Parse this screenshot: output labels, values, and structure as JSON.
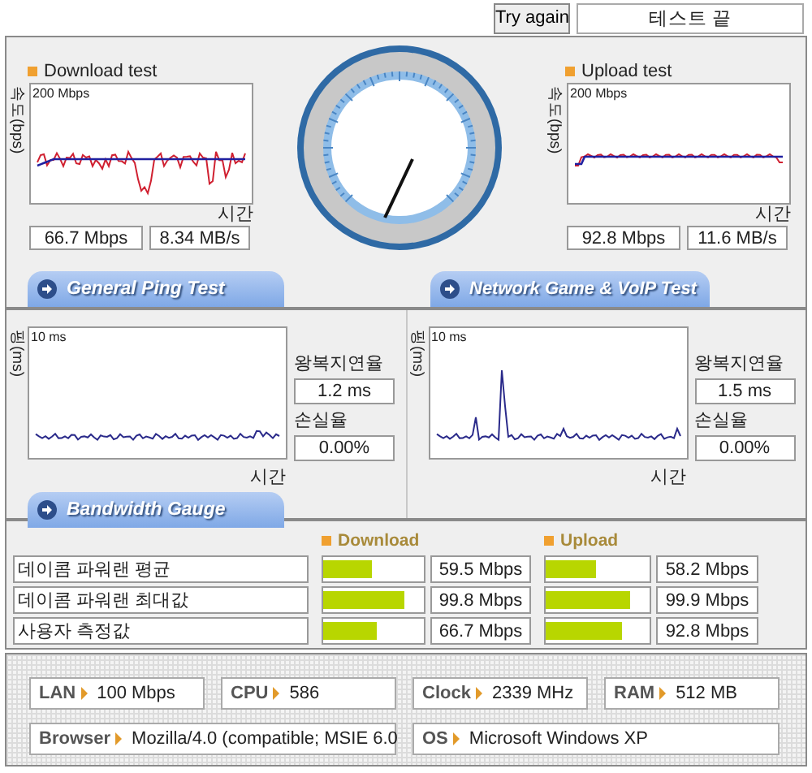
{
  "toolbar": {
    "retry_button": "Try again",
    "status": "테스트 끝"
  },
  "download": {
    "title": "Download test",
    "axis_label": "속도(bps)",
    "scale_label": "200 Mbps",
    "time_label": "시간",
    "rate": "66.7 Mbps",
    "bytes": "8.34 MB/s",
    "kind": "download"
  },
  "upload": {
    "title": "Upload test",
    "axis_label": "속도(bps)",
    "scale_label": "200 Mbps",
    "time_label": "시간",
    "rate": "92.8 Mbps",
    "bytes": "11.6 MB/s",
    "kind": "upload"
  },
  "ping_tab": "General Ping Test",
  "game_tab": "Network Game & VoIP Test",
  "ping": [
    {
      "axis_label": "핑(ms)",
      "scale_label": "10 ms",
      "time_label": "시간",
      "latency_label": "왕복지연율",
      "latency": "1.2 ms",
      "loss_label": "손실율",
      "loss": "0.00%",
      "kind": "flat"
    },
    {
      "axis_label": "핑(ms)",
      "scale_label": "10 ms",
      "time_label": "시간",
      "latency_label": "왕복지연율",
      "latency": "1.5 ms",
      "loss_label": "손실율",
      "loss": "0.00%",
      "kind": "spikes"
    }
  ],
  "bandwidth_tab": "Bandwidth Gauge",
  "bandwidth": {
    "download_heading": "Download",
    "upload_heading": "Upload",
    "rows": [
      {
        "label": "데이콤 파워랜 평균",
        "download": {
          "level": 0.49,
          "value": "59.5 Mbps"
        },
        "upload": {
          "level": 0.48,
          "value": "58.2 Mbps"
        }
      },
      {
        "label": "데이콤 파워랜 최대값",
        "download": {
          "level": 0.8,
          "value": "99.8 Mbps"
        },
        "upload": {
          "level": 0.81,
          "value": "99.9 Mbps"
        }
      },
      {
        "label": "사용자 측정값",
        "download": {
          "level": 0.54,
          "value": "66.7 Mbps"
        },
        "upload": {
          "level": 0.74,
          "value": "92.8 Mbps"
        }
      }
    ]
  },
  "system": [
    [
      {
        "label": "LAN",
        "value": "100 Mbps"
      },
      {
        "label": "CPU",
        "value": "586"
      },
      {
        "label": "Clock",
        "value": "2339 MHz"
      },
      {
        "label": "RAM",
        "value": "512 MB"
      }
    ],
    [
      {
        "label": "Browser",
        "value": "Mozilla/4.0 (compatible; MSIE 6.0"
      },
      {
        "label": "OS",
        "value": "Microsoft Windows XP"
      }
    ]
  ]
}
